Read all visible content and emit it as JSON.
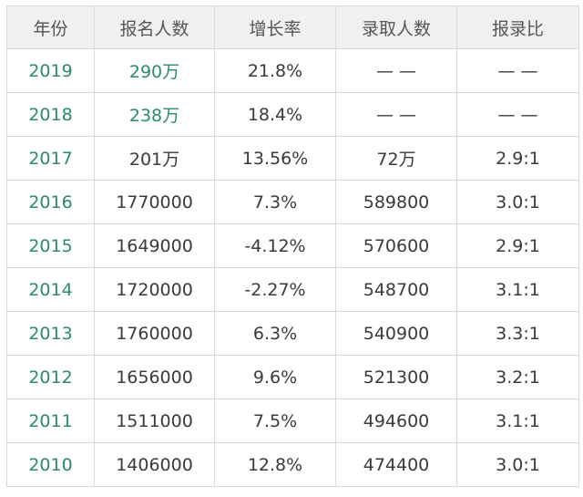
{
  "table": {
    "headers": [
      "年份",
      "报名人数",
      "增长率",
      "录取人数",
      "报录比"
    ],
    "rows": [
      {
        "year": "2019",
        "applicants": "290万",
        "growth": "21.8%",
        "admitted": "— —",
        "ratio": "— —",
        "highlight": true
      },
      {
        "year": "2018",
        "applicants": "238万",
        "growth": "18.4%",
        "admitted": "— —",
        "ratio": "— —",
        "highlight": true
      },
      {
        "year": "2017",
        "applicants": "201万",
        "growth": "13.56%",
        "admitted": "72万",
        "ratio": "2.9:1",
        "highlight": false
      },
      {
        "year": "2016",
        "applicants": "1770000",
        "growth": "7.3%",
        "admitted": "589800",
        "ratio": "3.0:1",
        "highlight": false
      },
      {
        "year": "2015",
        "applicants": "1649000",
        "growth": "-4.12%",
        "admitted": "570600",
        "ratio": "2.9:1",
        "highlight": false
      },
      {
        "year": "2014",
        "applicants": "1720000",
        "growth": "-2.27%",
        "admitted": "548700",
        "ratio": "3.1:1",
        "highlight": false
      },
      {
        "year": "2013",
        "applicants": "1760000",
        "growth": "6.3%",
        "admitted": "540900",
        "ratio": "3.3:1",
        "highlight": false
      },
      {
        "year": "2012",
        "applicants": "1656000",
        "growth": "9.6%",
        "admitted": "521300",
        "ratio": "3.2:1",
        "highlight": false
      },
      {
        "year": "2011",
        "applicants": "1511000",
        "growth": "7.5%",
        "admitted": "494600",
        "ratio": "3.1:1",
        "highlight": false
      },
      {
        "year": "2010",
        "applicants": "1406000",
        "growth": "12.8%",
        "admitted": "474400",
        "ratio": "3.0:1",
        "highlight": false
      }
    ]
  },
  "colors": {
    "accent_green": "#2b8a6e",
    "header_bg": "#f0f0f0",
    "border": "#d9d9d9",
    "text": "#3a3a3a"
  }
}
